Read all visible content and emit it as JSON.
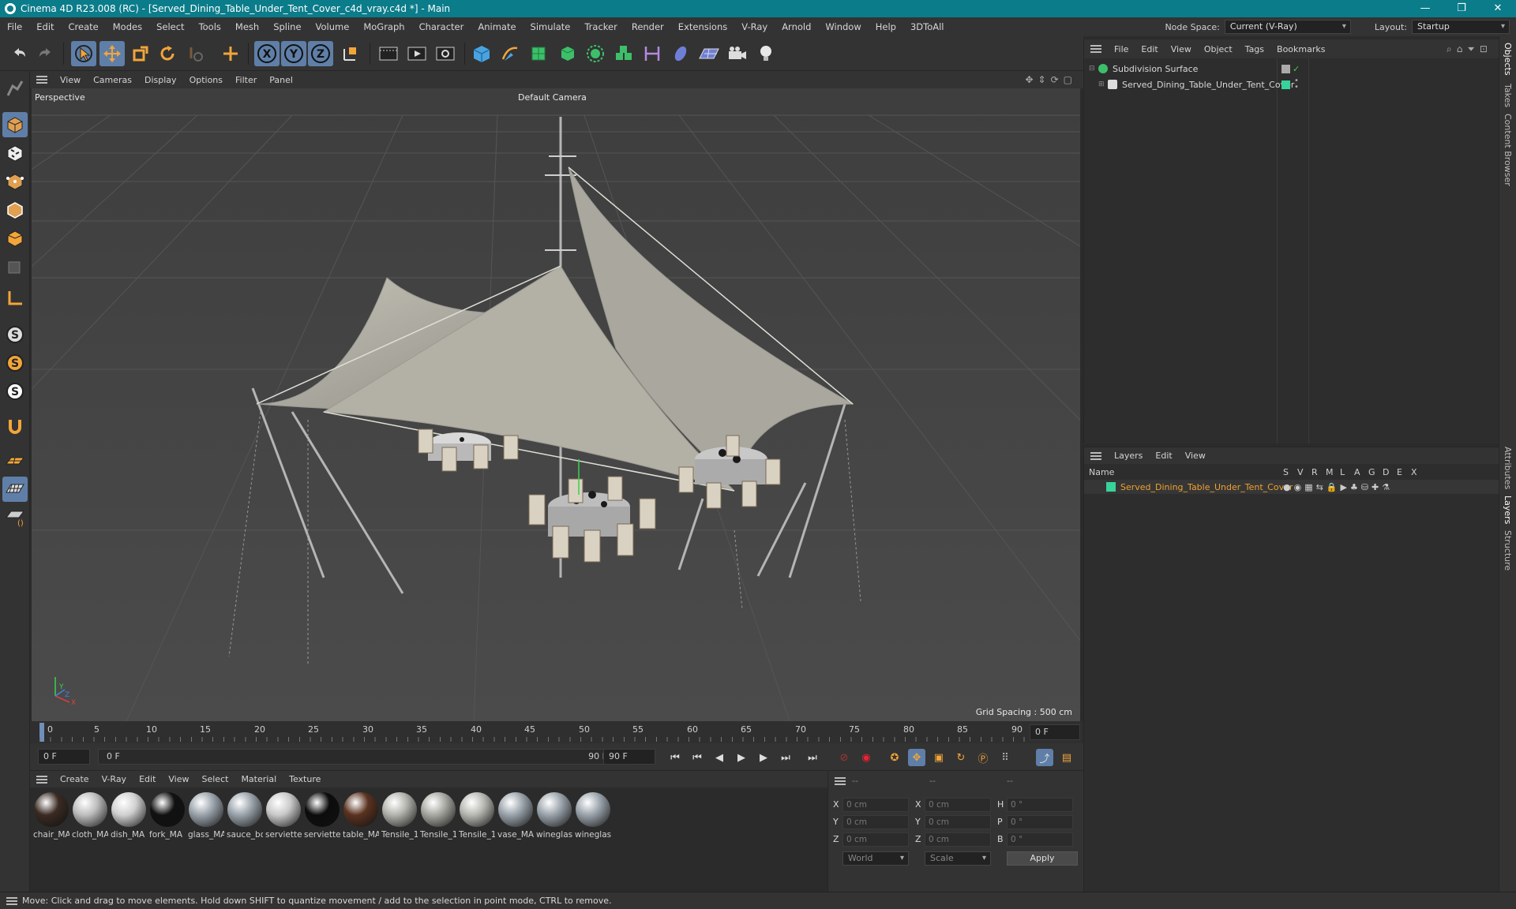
{
  "window": {
    "title": "Cinema 4D R23.008 (RC) - [Served_Dining_Table_Under_Tent_Cover_c4d_vray.c4d *] - Main",
    "controls": [
      "—",
      "❐",
      "✕"
    ]
  },
  "menubar": {
    "items": [
      "File",
      "Edit",
      "Create",
      "Modes",
      "Select",
      "Tools",
      "Mesh",
      "Spline",
      "Volume",
      "MoGraph",
      "Character",
      "Animate",
      "Simulate",
      "Tracker",
      "Render",
      "Extensions",
      "V-Ray",
      "Arnold",
      "Window",
      "Help",
      "3DToAll"
    ],
    "node_space_label": "Node Space:",
    "node_space_value": "Current (V-Ray)",
    "layout_label": "Layout:",
    "layout_value": "Startup"
  },
  "toolbar": {
    "icons": [
      "undo-icon",
      "redo-icon",
      "select-cursor-icon",
      "move-icon",
      "scale-icon",
      "rotate-icon",
      "live-select-icon",
      "add-icon",
      "x-axis-icon",
      "y-axis-icon",
      "z-axis-icon",
      "coordinate-system-icon",
      "render-view-icon",
      "render-picture-viewer-icon",
      "render-settings-icon",
      "cube-icon",
      "pen-icon",
      "subdivision-icon",
      "extrude-icon",
      "cloner-icon",
      "array-icon",
      "spline-tool-icon",
      "deformer-icon",
      "floor-icon",
      "camera-icon",
      "light-icon"
    ]
  },
  "viewport": {
    "menu": [
      "View",
      "Cameras",
      "Display",
      "Options",
      "Filter",
      "Panel"
    ],
    "projection_label": "Perspective",
    "camera_label": "Default Camera",
    "grid_spacing": "Grid Spacing : 500 cm",
    "axis_labels": {
      "y": "Y",
      "z": "Z",
      "x": "X"
    }
  },
  "timeline": {
    "ticks": [
      "0",
      "5",
      "10",
      "15",
      "20",
      "25",
      "30",
      "35",
      "40",
      "45",
      "50",
      "55",
      "60",
      "65",
      "70",
      "75",
      "80",
      "85",
      "90"
    ],
    "current_frame": "0 F",
    "start_frame": "0 F",
    "range_start": "0 F",
    "range_end": "90 F",
    "end_frame": "90 F"
  },
  "materials": {
    "menu": [
      "Create",
      "V-Ray",
      "Edit",
      "View",
      "Select",
      "Material",
      "Texture"
    ],
    "items": [
      {
        "label": "chair_MA",
        "color": "#3a2a22"
      },
      {
        "label": "cloth_MA",
        "color": "#bdbdbd"
      },
      {
        "label": "dish_MA",
        "color": "#d0d0d0"
      },
      {
        "label": "fork_MA",
        "color": "#111111"
      },
      {
        "label": "glass_MA",
        "color": "#9aa3ab"
      },
      {
        "label": "sauce_bo",
        "color": "#9aa3ab"
      },
      {
        "label": "serviette",
        "color": "#c9c9c9"
      },
      {
        "label": "serviette",
        "color": "#0c0c0c"
      },
      {
        "label": "table_MA",
        "color": "#5a3220"
      },
      {
        "label": "Tensile_1",
        "color": "#b3b3ad"
      },
      {
        "label": "Tensile_1",
        "color": "#a8a8a2"
      },
      {
        "label": "Tensile_1",
        "color": "#b7b7b2"
      },
      {
        "label": "vase_MA",
        "color": "#9aa3ab"
      },
      {
        "label": "wineglas",
        "color": "#9aa3ab"
      },
      {
        "label": "wineglas",
        "color": "#9aa3ab"
      }
    ]
  },
  "coordinates": {
    "headers": [
      "--",
      "--",
      "--"
    ],
    "rows": [
      {
        "l1": "X",
        "v1": "0 cm",
        "l2": "X",
        "v2": "0 cm",
        "l3": "H",
        "v3": "0 °"
      },
      {
        "l1": "Y",
        "v1": "0 cm",
        "l2": "Y",
        "v2": "0 cm",
        "l3": "P",
        "v3": "0 °"
      },
      {
        "l1": "Z",
        "v1": "0 cm",
        "l2": "Z",
        "v2": "0 cm",
        "l3": "B",
        "v3": "0 °"
      }
    ],
    "space": "World",
    "mode": "Scale",
    "apply": "Apply"
  },
  "objects": {
    "menu": [
      "File",
      "Edit",
      "View",
      "Object",
      "Tags",
      "Bookmarks"
    ],
    "tree": [
      {
        "name": "Subdivision Surface"
      },
      {
        "name": "Served_Dining_Table_Under_Tent_Cover"
      }
    ]
  },
  "layers": {
    "menu": [
      "Layers",
      "Edit",
      "View"
    ],
    "name_header": "Name",
    "flag_headers": [
      "S",
      "V",
      "R",
      "M",
      "L",
      "A",
      "G",
      "D",
      "E",
      "X"
    ],
    "rows": [
      {
        "name": "Served_Dining_Table_Under_Tent_Cover",
        "color": "#37d39a"
      }
    ]
  },
  "side_tabs": [
    "Objects",
    "Takes",
    "Content Browser",
    "Attributes",
    "Layers",
    "Structure"
  ],
  "status": {
    "text": "Move: Click and drag to move elements. Hold down SHIFT to quantize movement / add to the selection in point mode, CTRL to remove."
  },
  "colors": {
    "title_bar": "#0b7c8a",
    "active_tool": "#5f7fa8",
    "layer_green": "#37d39a",
    "layer_name_orange": "#f0a030"
  }
}
